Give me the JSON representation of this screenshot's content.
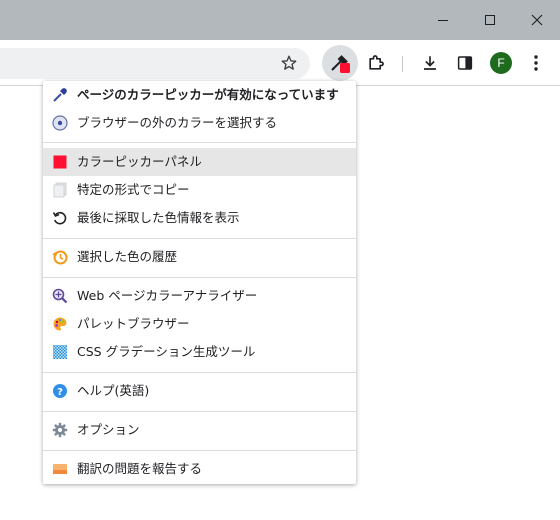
{
  "window": {
    "minimize_icon": "minimize-icon",
    "maximize_icon": "maximize-icon",
    "close_icon": "close-icon"
  },
  "toolbar": {
    "icons": [
      "star-icon",
      "eyedropper-extension-icon",
      "puzzle-icon",
      "download-icon",
      "side-panel-icon",
      "profile-avatar"
    ],
    "profile_initial": "F",
    "profile_color": "#1e6b1e",
    "extension_badge_color": "#ff1032"
  },
  "menu": {
    "items": [
      {
        "label": "ページのカラーピッカーが有効になっています",
        "icon": "eyedropper-icon",
        "bold": true
      },
      {
        "label": "ブラウザーの外のカラーを選択する",
        "icon": "screen-picker-icon"
      },
      {
        "label": "カラーピッカーパネル",
        "icon": "color-swatch-icon",
        "swatch": "#ff1032"
      },
      {
        "label": "特定の形式でコピー",
        "icon": "copy-icon"
      },
      {
        "label": "最後に採取した色情報を表示",
        "icon": "history-arrow-icon"
      },
      {
        "label": "選択した色の履歴",
        "icon": "clock-history-icon"
      },
      {
        "label": "Web ページカラーアナライザー",
        "icon": "analyzer-icon"
      },
      {
        "label": "パレットブラウザー",
        "icon": "palette-icon"
      },
      {
        "label": "CSS グラデーション生成ツール",
        "icon": "gradient-icon"
      },
      {
        "label": "ヘルプ(英語)",
        "icon": "help-icon"
      },
      {
        "label": "オプション",
        "icon": "gear-icon"
      },
      {
        "label": "翻訳の問題を報告する",
        "icon": "report-icon"
      }
    ]
  }
}
